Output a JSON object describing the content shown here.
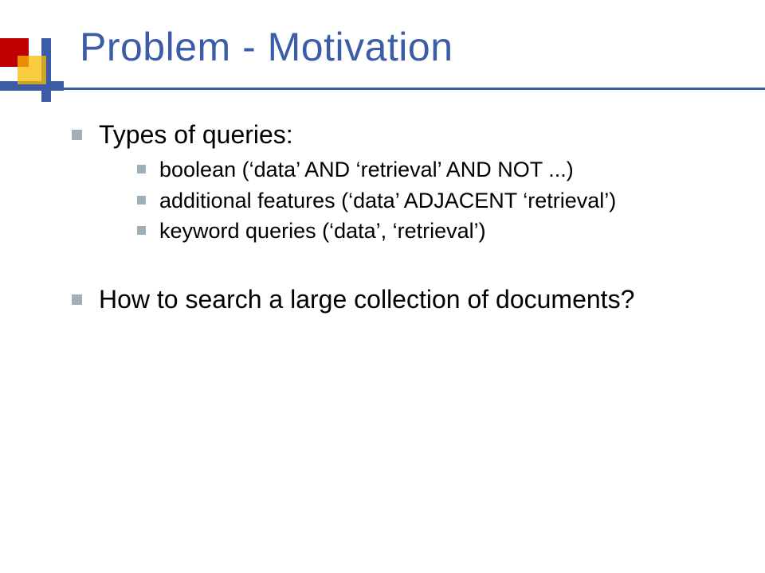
{
  "slide": {
    "title": "Problem - Motivation",
    "bullets": [
      {
        "text": "Types of queries:",
        "sub": [
          "boolean (‘data’ AND ‘retrieval’ AND NOT ...)",
          "additional features (‘data’ ADJACENT ‘retrieval’)",
          "keyword queries (‘data’, ‘retrieval’)"
        ]
      },
      {
        "text": "How to search a large collection of documents?",
        "sub": []
      }
    ]
  },
  "colors": {
    "title": "#3c5ca8",
    "bullet": "#a0b0b8",
    "accent_red": "#c00000",
    "accent_yellow": "#f8bc00"
  }
}
